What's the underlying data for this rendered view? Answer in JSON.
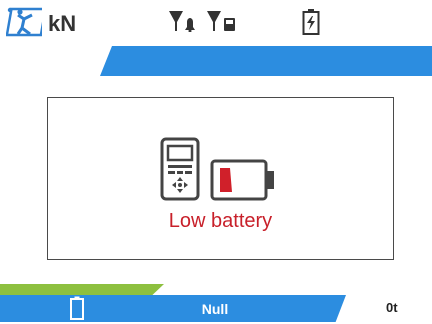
{
  "status_bar": {
    "unit": "kN",
    "icons": [
      "crane-operator-icon",
      "signal-bell-icon",
      "signal-device-icon",
      "battery-charging-icon"
    ]
  },
  "dialog": {
    "message": "Low battery",
    "icons": [
      "remote-controller-icon",
      "low-battery-icon"
    ]
  },
  "bottom_bar": {
    "center_label": "Null",
    "right_label": "0t",
    "icon": "battery-outline-icon"
  },
  "colors": {
    "accent_blue": "#2c8de0",
    "accent_green": "#8dc03f",
    "warning_red": "#c8202a",
    "logo_blue": "#2f80d0"
  }
}
